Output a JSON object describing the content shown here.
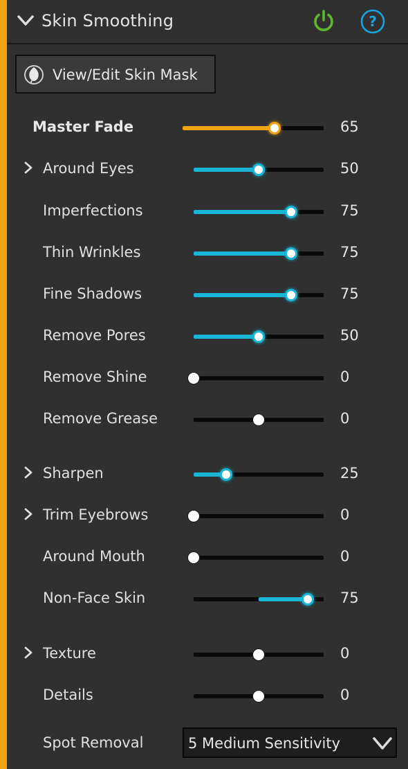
{
  "colors": {
    "accent_orange": "#f0a412",
    "slider_cyan": "#19b6d6",
    "power_green": "#5cb82e",
    "help_blue": "#1aa3e0"
  },
  "header": {
    "title": "Skin Smoothing",
    "collapse_icon": "chevron-down-icon",
    "power_icon": "power-icon",
    "help_icon": "help-icon"
  },
  "mask_button": {
    "label": "View/Edit Skin Mask",
    "icon": "skin-mask-icon"
  },
  "sliders": [
    {
      "label": "Master Fade",
      "value": "65",
      "fraction": 0.65,
      "expander": false,
      "master": true
    },
    {
      "label": "Around Eyes",
      "value": "50",
      "fraction": 0.5,
      "expander": true
    },
    {
      "label": "Imperfections",
      "value": "75",
      "fraction": 0.75,
      "expander": false
    },
    {
      "label": "Thin Wrinkles",
      "value": "75",
      "fraction": 0.75,
      "expander": false
    },
    {
      "label": "Fine Shadows",
      "value": "75",
      "fraction": 0.75,
      "expander": false
    },
    {
      "label": "Remove Pores",
      "value": "50",
      "fraction": 0.5,
      "expander": false
    },
    {
      "label": "Remove Shine",
      "value": "0",
      "fraction": 0,
      "expander": false
    },
    {
      "label": "Remove Grease",
      "value": "0",
      "fraction": 0,
      "expander": false,
      "centered": true
    },
    {
      "label": "Sharpen",
      "value": "25",
      "fraction": 0.25,
      "expander": true
    },
    {
      "label": "Trim Eyebrows",
      "value": "0",
      "fraction": 0,
      "expander": true
    },
    {
      "label": "Around Mouth",
      "value": "0",
      "fraction": 0,
      "expander": false
    },
    {
      "label": "Non-Face Skin",
      "value": "75",
      "fraction": 0.75,
      "expander": false,
      "centered": true
    },
    {
      "label": "Texture",
      "value": "0",
      "fraction": 0,
      "expander": true,
      "centered": true
    },
    {
      "label": "Details",
      "value": "0",
      "fraction": 0,
      "expander": false,
      "centered": true
    }
  ],
  "spot_removal": {
    "label": "Spot Removal",
    "selected": "5 Medium Sensitivity"
  }
}
